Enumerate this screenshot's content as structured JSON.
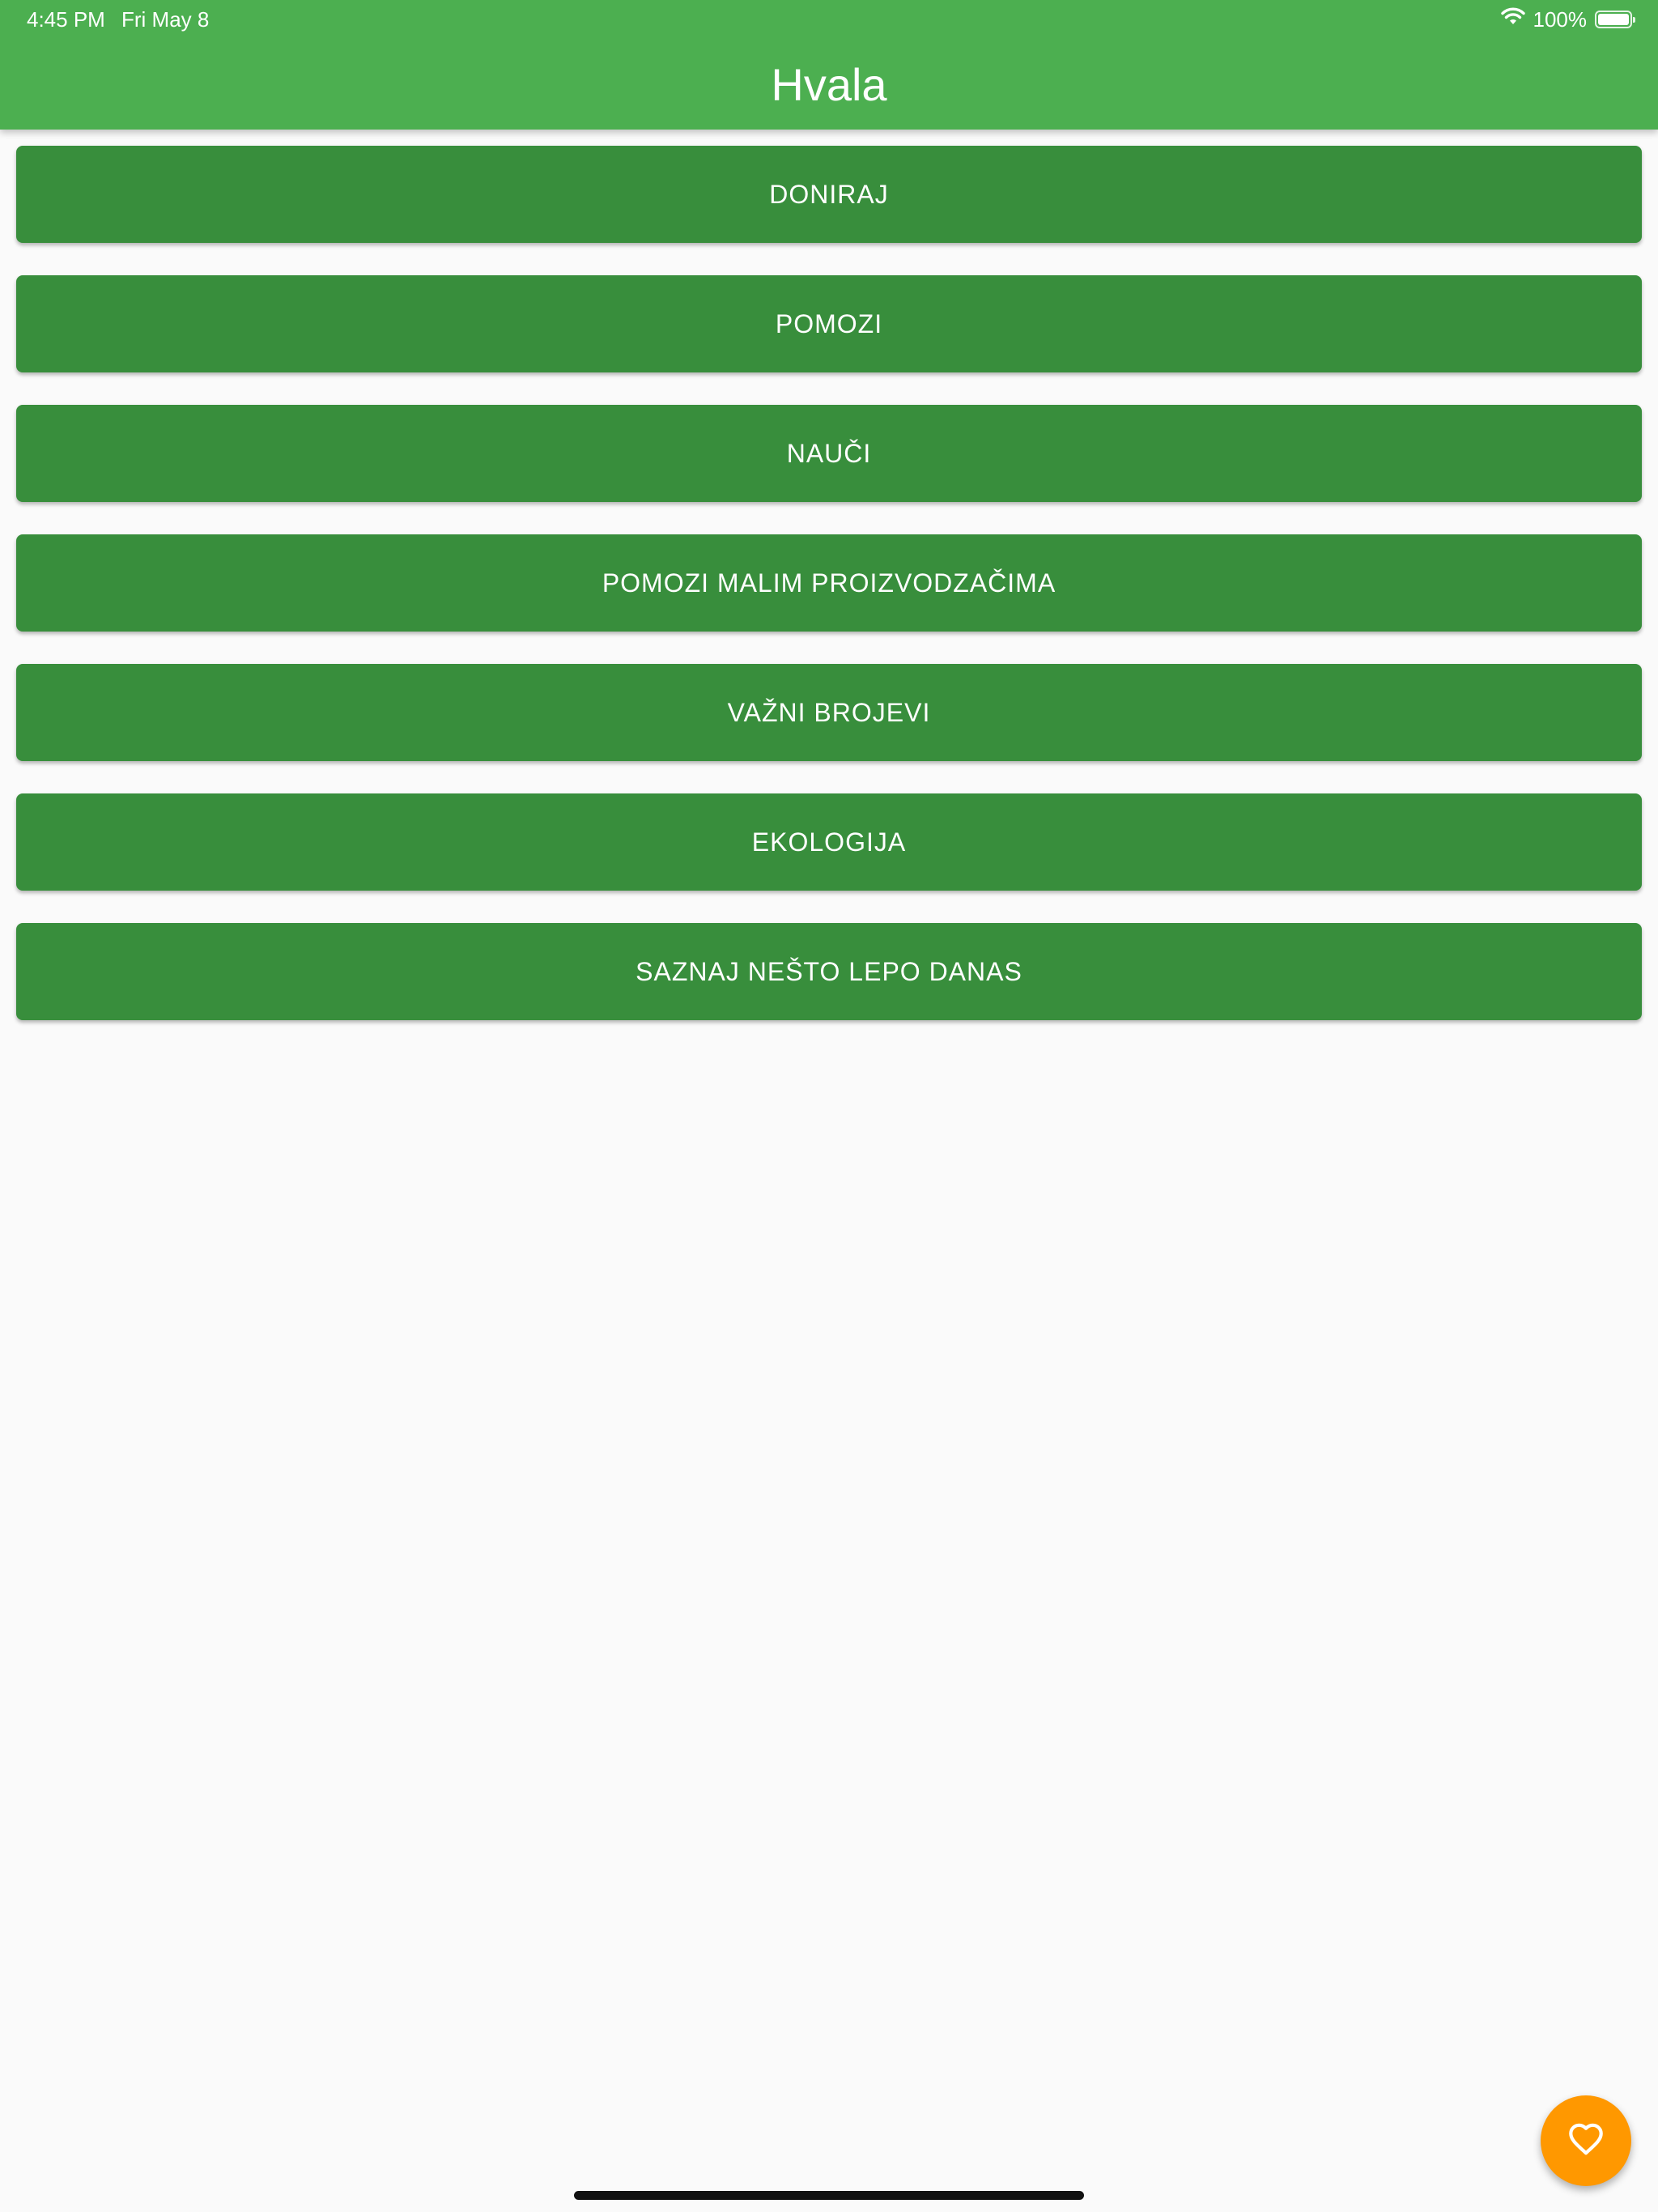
{
  "status_bar": {
    "time": "4:45 PM",
    "date": "Fri May 8",
    "battery_percent": "100%",
    "battery_level": 1.0,
    "wifi_icon": "wifi-icon",
    "battery_icon": "battery-icon"
  },
  "appbar": {
    "title": "Hvala",
    "background": "#4caf50"
  },
  "menu": {
    "button_color": "#388e3c",
    "items": [
      {
        "label": "DONIRAJ"
      },
      {
        "label": "POMOZI"
      },
      {
        "label": "NAUČI"
      },
      {
        "label": "POMOZI MALIM PROIZVODZAČIMA"
      },
      {
        "label": "VAŽNI BROJEVI"
      },
      {
        "label": "EKOLOGIJA"
      },
      {
        "label": "SAZNAJ NEŠTO LEPO DANAS"
      }
    ]
  },
  "fab": {
    "icon": "heart-outline-icon",
    "color": "#ff9800"
  }
}
